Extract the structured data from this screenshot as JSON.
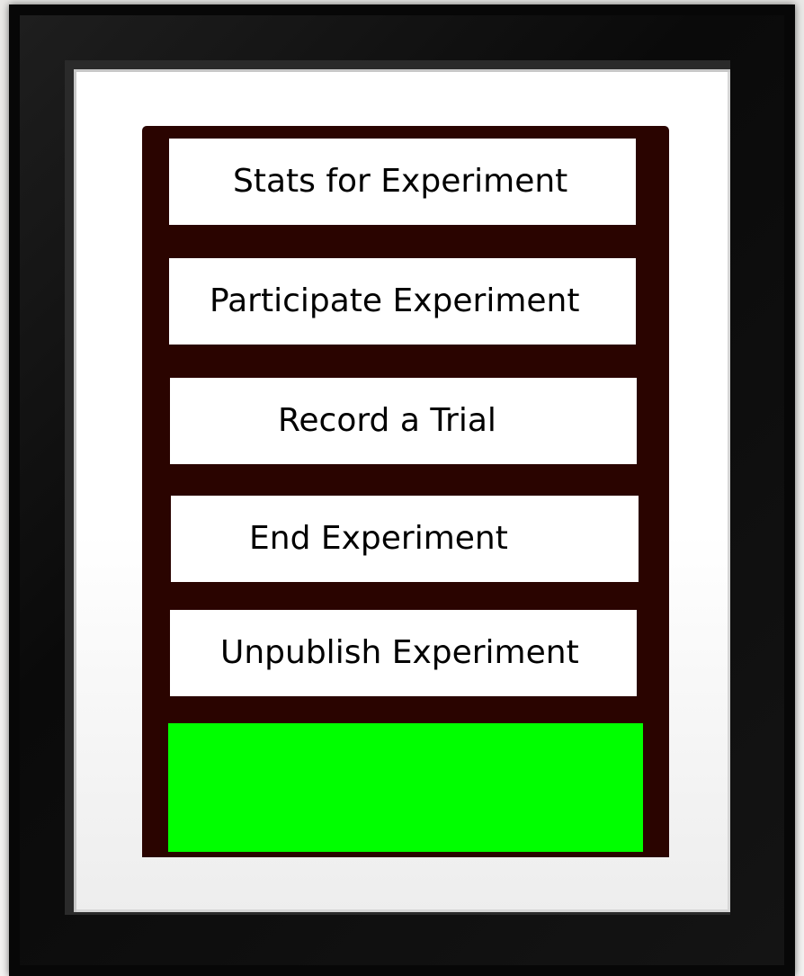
{
  "menu": {
    "items": [
      {
        "label": "Stats for Experiment"
      },
      {
        "label": "Participate Experiment"
      },
      {
        "label": "Record a Trial"
      },
      {
        "label": "End Experiment"
      },
      {
        "label": "Unpublish Experiment"
      }
    ]
  },
  "status": {
    "color": "#00ff00"
  },
  "colors": {
    "panel": "#2a0400",
    "frame": "#070707",
    "button_background": "#ffffff"
  }
}
